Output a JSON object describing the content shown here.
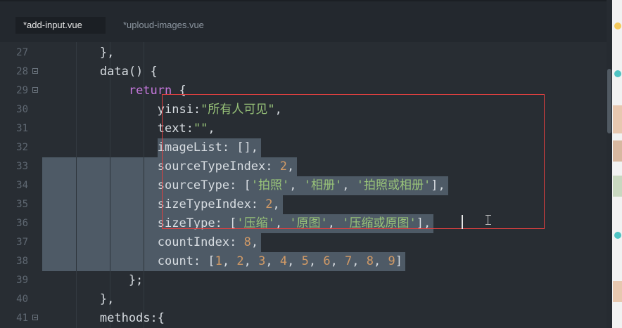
{
  "tabs": [
    {
      "label": "*add-input.vue"
    },
    {
      "label": "*uploud-images.vue"
    }
  ],
  "lines": [
    {
      "num": "27",
      "fold": false,
      "code": [
        {
          "t": "        },",
          "c": "plain"
        }
      ]
    },
    {
      "num": "28",
      "fold": true,
      "code": [
        {
          "t": "        data() {",
          "c": "plain"
        }
      ]
    },
    {
      "num": "29",
      "fold": true,
      "code": [
        {
          "t": "            ",
          "c": "plain"
        },
        {
          "t": "return",
          "c": "kw"
        },
        {
          "t": " {",
          "c": "plain"
        }
      ]
    },
    {
      "num": "30",
      "fold": false,
      "code": [
        {
          "t": "                yinsi:",
          "c": "plain"
        },
        {
          "t": "\"所有人可见\"",
          "c": "str"
        },
        {
          "t": ",",
          "c": "plain"
        }
      ]
    },
    {
      "num": "31",
      "fold": false,
      "code": [
        {
          "t": "                text:",
          "c": "plain"
        },
        {
          "t": "\"\"",
          "c": "str"
        },
        {
          "t": ",",
          "c": "plain"
        }
      ]
    },
    {
      "num": "32",
      "fold": false,
      "code": [
        {
          "t": "                imageList: [],",
          "c": "plain"
        }
      ]
    },
    {
      "num": "33",
      "fold": false,
      "code": [
        {
          "t": "                sourceTypeIndex: ",
          "c": "plain"
        },
        {
          "t": "2",
          "c": "num"
        },
        {
          "t": ",",
          "c": "plain"
        }
      ]
    },
    {
      "num": "34",
      "fold": false,
      "code": [
        {
          "t": "                sourceType: [",
          "c": "plain"
        },
        {
          "t": "'拍照'",
          "c": "str"
        },
        {
          "t": ", ",
          "c": "plain"
        },
        {
          "t": "'相册'",
          "c": "str"
        },
        {
          "t": ", ",
          "c": "plain"
        },
        {
          "t": "'拍照或相册'",
          "c": "str"
        },
        {
          "t": "],",
          "c": "plain"
        }
      ]
    },
    {
      "num": "35",
      "fold": false,
      "code": [
        {
          "t": "                sizeTypeIndex: ",
          "c": "plain"
        },
        {
          "t": "2",
          "c": "num"
        },
        {
          "t": ",",
          "c": "plain"
        }
      ]
    },
    {
      "num": "36",
      "fold": false,
      "code": [
        {
          "t": "                sizeType: [",
          "c": "plain"
        },
        {
          "t": "'压缩'",
          "c": "str"
        },
        {
          "t": ", ",
          "c": "plain"
        },
        {
          "t": "'原图'",
          "c": "str"
        },
        {
          "t": ", ",
          "c": "plain"
        },
        {
          "t": "'压缩或原图'",
          "c": "str"
        },
        {
          "t": "],",
          "c": "plain"
        }
      ]
    },
    {
      "num": "37",
      "fold": false,
      "code": [
        {
          "t": "                countIndex: ",
          "c": "plain"
        },
        {
          "t": "8",
          "c": "num"
        },
        {
          "t": ",",
          "c": "plain"
        }
      ]
    },
    {
      "num": "38",
      "fold": false,
      "code": [
        {
          "t": "                count: [",
          "c": "plain"
        },
        {
          "t": "1",
          "c": "num"
        },
        {
          "t": ", ",
          "c": "plain"
        },
        {
          "t": "2",
          "c": "num"
        },
        {
          "t": ", ",
          "c": "plain"
        },
        {
          "t": "3",
          "c": "num"
        },
        {
          "t": ", ",
          "c": "plain"
        },
        {
          "t": "4",
          "c": "num"
        },
        {
          "t": ", ",
          "c": "plain"
        },
        {
          "t": "5",
          "c": "num"
        },
        {
          "t": ", ",
          "c": "plain"
        },
        {
          "t": "6",
          "c": "num"
        },
        {
          "t": ", ",
          "c": "plain"
        },
        {
          "t": "7",
          "c": "num"
        },
        {
          "t": ", ",
          "c": "plain"
        },
        {
          "t": "8",
          "c": "num"
        },
        {
          "t": ", ",
          "c": "plain"
        },
        {
          "t": "9",
          "c": "num"
        },
        {
          "t": "]",
          "c": "plain"
        }
      ]
    },
    {
      "num": "39",
      "fold": false,
      "code": [
        {
          "t": "            };",
          "c": "plain"
        }
      ]
    },
    {
      "num": "40",
      "fold": false,
      "code": [
        {
          "t": "        },",
          "c": "plain"
        }
      ]
    },
    {
      "num": "41",
      "fold": true,
      "code": [
        {
          "t": "        methods:{",
          "c": "plain"
        }
      ]
    }
  ],
  "colors": {
    "background": "#282d33",
    "selection": "#4e5a66",
    "keyword": "#c678dd",
    "string": "#98c379",
    "number": "#d19a66",
    "highlight_box": "#e04040"
  },
  "icons": [
    "fold-toggle-icon",
    "ibeam-cursor-icon"
  ]
}
